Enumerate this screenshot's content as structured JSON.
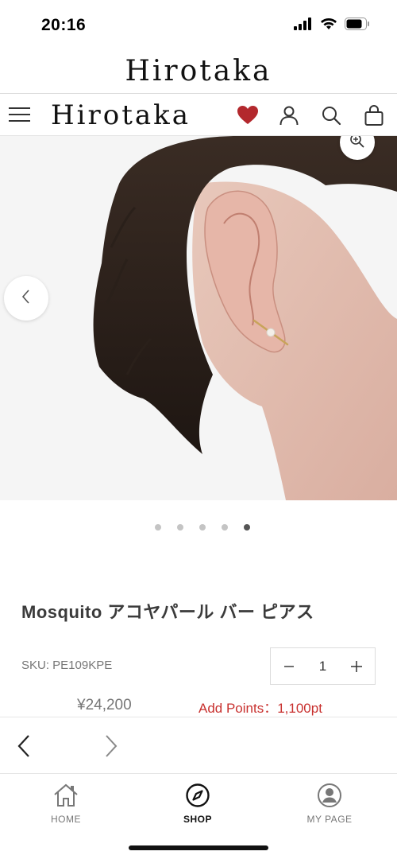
{
  "status_bar": {
    "time": "20:16",
    "icons": [
      "signal-icon",
      "wifi-icon",
      "battery-icon"
    ]
  },
  "browser": {
    "title": "Hirotaka"
  },
  "header": {
    "logo": "Hirotaka",
    "icons": [
      "menu-icon",
      "heart-icon",
      "user-icon",
      "search-icon",
      "bag-icon"
    ],
    "heart_color": "#b3282d"
  },
  "gallery": {
    "slide_count": 5,
    "active_slide": 5,
    "icons": [
      "zoom-in-icon",
      "chevron-left-icon"
    ]
  },
  "product": {
    "title": "Mosquito アコヤパール バー ピアス",
    "sku": "SKU: PE109KPE",
    "quantity": "1",
    "price": "¥24,200",
    "points": "Add Points：1,100pt",
    "points_color": "#c8302e"
  },
  "browser_nav": {
    "icons": [
      "back-arrow-icon",
      "forward-arrow-icon"
    ]
  },
  "tab_bar": {
    "tabs": [
      {
        "label": "HOME",
        "icon": "home-icon"
      },
      {
        "label": "SHOP",
        "icon": "compass-icon"
      },
      {
        "label": "MY PAGE",
        "icon": "user-circle-icon"
      }
    ],
    "active": "SHOP"
  }
}
